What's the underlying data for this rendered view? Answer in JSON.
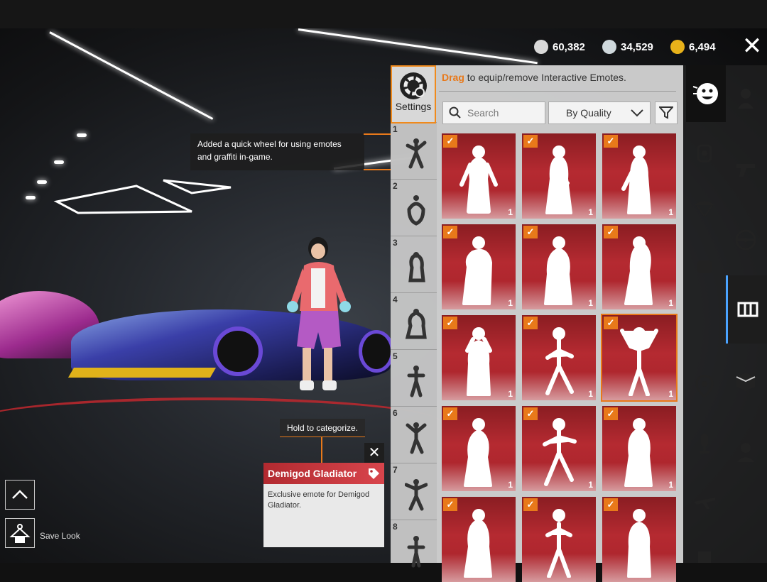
{
  "currencies": [
    {
      "icon": "bp-coin-icon",
      "value": "60,382",
      "color": "#d9d9d9"
    },
    {
      "icon": "silver-fragment-icon",
      "value": "34,529",
      "color": "#cfd8dc"
    },
    {
      "icon": "uc-icon",
      "value": "6,494",
      "color": "#e8b21a"
    }
  ],
  "close_label": "✕",
  "tip_wheel": "Added a quick wheel for using emotes and graffiti in-game.",
  "settings_label": "Settings",
  "hint": {
    "highlight": "Drag",
    "rest": " to equip/remove Interactive Emotes."
  },
  "search_placeholder": "Search",
  "sort_label": "By Quality",
  "slots": [
    "1",
    "2",
    "3",
    "4",
    "5",
    "6",
    "7",
    "8"
  ],
  "emote_tiles": [
    {
      "count": "1",
      "checked": true
    },
    {
      "count": "1",
      "checked": true
    },
    {
      "count": "1",
      "checked": true
    },
    {
      "count": "1",
      "checked": true
    },
    {
      "count": "1",
      "checked": true
    },
    {
      "count": "1",
      "checked": true
    },
    {
      "count": "1",
      "checked": true
    },
    {
      "count": "1",
      "checked": true
    },
    {
      "count": "1",
      "checked": true,
      "selected": true
    },
    {
      "count": "1",
      "checked": true
    },
    {
      "count": "1",
      "checked": true
    },
    {
      "count": "1",
      "checked": true
    },
    {
      "count": "",
      "checked": true
    },
    {
      "count": "",
      "checked": true
    },
    {
      "count": "",
      "checked": true
    }
  ],
  "hold_tip": "Hold to categorize.",
  "card": {
    "title": "Demigod Gladiator",
    "desc": "Exclusive emote for Demigod Gladiator.",
    "close": "✕"
  },
  "save_look": "Save Look",
  "accent": "#e8791a"
}
